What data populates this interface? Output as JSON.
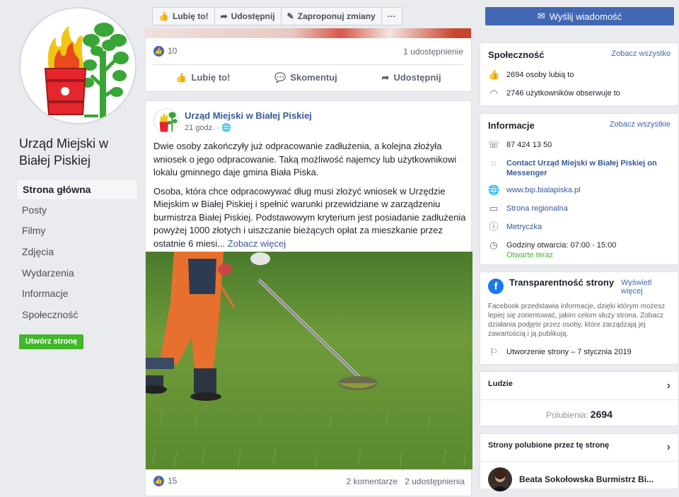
{
  "page": {
    "name": "Urząd Miejski w Białej Piskiej"
  },
  "nav": {
    "items": [
      {
        "label": "Strona główna"
      },
      {
        "label": "Posty"
      },
      {
        "label": "Filmy"
      },
      {
        "label": "Zdjęcia"
      },
      {
        "label": "Wydarzenia"
      },
      {
        "label": "Informacje"
      },
      {
        "label": "Społeczność"
      }
    ],
    "create_page": "Utwórz stronę"
  },
  "toolbar": {
    "like": "Lubię to!",
    "share": "Udostępnij",
    "suggest": "Zaproponuj zmiany",
    "more": "···"
  },
  "feed1": {
    "likes": "10",
    "shares": "1 udostępnienie",
    "like_action": "Lubię to!",
    "comment_action": "Skomentuj",
    "share_action": "Udostępnij"
  },
  "post": {
    "author": "Urząd Miejski w Białej Piskiej",
    "time": "21 godz. ·",
    "paragraph1": "Dwie osoby zakończyły już odpracowanie zadłużenia, a kolejna złożyła wniosek o jego odpracowanie. Taką możliwość najemcy lub użytkownikowi lokalu gminnego daje gmina Biała Piska.",
    "paragraph2": "Osoba, która chce odpracowywać dług musi złożyć wniosek w Urzędzie Miejskim w Białej Piskiej i spełnić warunki przewidziane w zarządzeniu burmistrza Białej Piskiej. Podstawowym kryterium jest posiadanie zadłużenia powyżej 1000 złotych i uiszczanie bieżących opłat za mieszkanie przez ostatnie 6 miesi...",
    "see_more": "Zobacz więcej",
    "likes": "15",
    "comments": "2 komentarze",
    "shares": "2 udostępnienia"
  },
  "sidebar": {
    "message_button": "Wyślij wiadomość",
    "community": {
      "title": "Społeczność",
      "see_all": "Zobacz wszystko",
      "likes": "2694 osoby lubią to",
      "followers": "2746 użytkowników obserwuje to"
    },
    "info": {
      "title": "Informacje",
      "see_all": "Zobacz wszystkie",
      "phone": "87 424 13 50",
      "messenger": "Contact Urząd Miejski w Białej Piskiej on Messenger",
      "website": "www.bip.bialapiska.pl",
      "category": "Strona regionalna",
      "metric": "Metryczka",
      "hours": "Godziny otwarcia: 07:00 - 15:00",
      "open_now": "Otwarte teraz"
    },
    "transparency": {
      "title": "Transparentność strony",
      "see_more": "Wyświetl więcej",
      "description": "Facebook przedstawia informacje, dzięki którym możesz lepiej się zorientować, jakim celom służy strona. Zobacz działania podjęte przez osoby, które zarządzają jej zawartością i ją publikują.",
      "created": "Utworzenie strony – 7 stycznia 2019"
    },
    "people": {
      "title": "Ludzie",
      "likes_label": "Polubienia:",
      "likes_value": "2694"
    },
    "liked_pages": {
      "title": "Strony polubione przez tę stronę",
      "first": "Beata Sokołowska Burmistrz Bi..."
    }
  },
  "colors": {
    "brand": "#4267b2",
    "green": "#42b72a",
    "background": "#e9ebee"
  }
}
